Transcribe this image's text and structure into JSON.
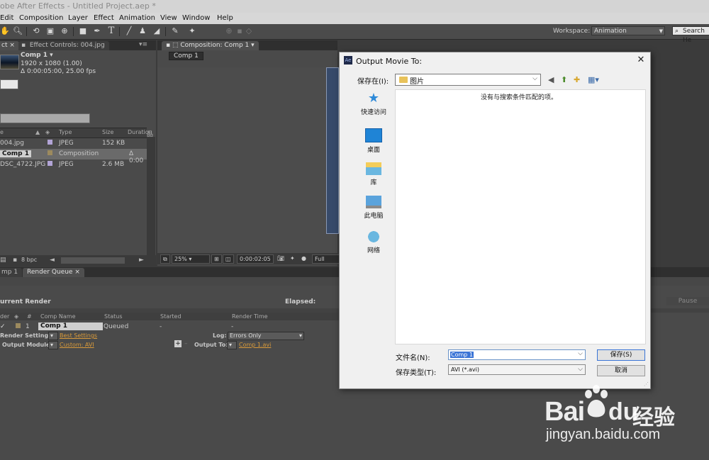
{
  "window": {
    "title": "obe After Effects - Untitled Project.aep *"
  },
  "menu": [
    "Edit",
    "Composition",
    "Layer",
    "Effect",
    "Animation",
    "View",
    "Window",
    "Help"
  ],
  "toolbar": {
    "tools": [
      "hand-icon",
      "zoom-icon",
      "rotate-icon",
      "camera-icon",
      "pan-behind-icon",
      "rectangle-icon",
      "pen-icon",
      "type-icon",
      "brush-icon",
      "clone-stamp-icon",
      "eraser-icon",
      "roto-brush-icon",
      "puppet-pin-icon"
    ],
    "workspace_label": "Workspace:",
    "workspace_value": "Animation",
    "search_label": "Search He"
  },
  "project_panel": {
    "tab_label": "ct",
    "effect_controls_tab": "Effect Controls: 004.jpg",
    "comp_name": "Comp 1 ▾",
    "comp_res": "1920 x 1080 (1.00)",
    "comp_duration": "Δ 0:00:05:00, 25.00 fps",
    "columns": [
      "e",
      "Type",
      "Size",
      "Duration"
    ],
    "rows": [
      {
        "name": "004.jpg",
        "type": "JPEG",
        "size": "152 KB",
        "duration": "",
        "color": "#b2a4d6"
      },
      {
        "name": "Comp 1",
        "type": "Composition",
        "size": "",
        "duration": "Δ 0:00",
        "color": "#9c8a5e"
      },
      {
        "name": "DSC_4722.JPG",
        "type": "JPEG",
        "size": "2.6 MB",
        "duration": "",
        "color": "#b2a4d6"
      }
    ],
    "bpc": "8 bpc"
  },
  "comp_panel": {
    "tab_label": "Composition: Comp 1",
    "comp_button": "Comp 1",
    "zoom": "25%",
    "timecode": "0:00:02:05",
    "resolution": "Full"
  },
  "render_queue": {
    "tabs": [
      "mp 1",
      "Render Queue"
    ],
    "current_render": "urrent Render",
    "elapsed": "Elapsed:",
    "pause": "Pause",
    "columns": [
      "der",
      "#",
      "Comp Name",
      "Status",
      "Started",
      "Render Time"
    ],
    "item": {
      "index": "1",
      "comp": "Comp 1",
      "status": "Queued",
      "started": "-",
      "render_time": "-"
    },
    "render_settings_label": "Render Settings:",
    "render_settings_value": "Best Settings",
    "log_label": "Log:",
    "log_value": "Errors Only",
    "output_module_label": "Output Module:",
    "output_module_value": "Custom: AVI",
    "output_to_label": "Output To:",
    "output_to_value": "Comp 1.avi"
  },
  "dialog": {
    "title": "Output Movie To:",
    "lookin_label": "保存在(I):",
    "lookin_value": "图片",
    "empty_message": "没有与搜索条件匹配的项。",
    "places": [
      "快速访问",
      "桌面",
      "库",
      "此电脑",
      "网络"
    ],
    "filename_label": "文件名(N):",
    "filename_value": "Comp 1",
    "filetype_label": "保存类型(T):",
    "filetype_value": "AVI (*.avi)",
    "save_button": "保存(S)",
    "cancel_button": "取消"
  },
  "watermark": {
    "brand_left": "Bai",
    "brand_right": "经验",
    "url": "jingyan.baidu.com"
  }
}
